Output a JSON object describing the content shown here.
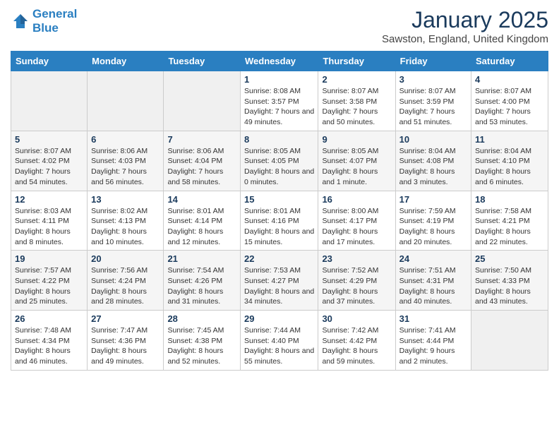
{
  "header": {
    "logo_line1": "General",
    "logo_line2": "Blue",
    "month": "January 2025",
    "location": "Sawston, England, United Kingdom"
  },
  "weekdays": [
    "Sunday",
    "Monday",
    "Tuesday",
    "Wednesday",
    "Thursday",
    "Friday",
    "Saturday"
  ],
  "weeks": [
    [
      {
        "day": "",
        "info": ""
      },
      {
        "day": "",
        "info": ""
      },
      {
        "day": "",
        "info": ""
      },
      {
        "day": "1",
        "info": "Sunrise: 8:08 AM\nSunset: 3:57 PM\nDaylight: 7 hours\nand 49 minutes."
      },
      {
        "day": "2",
        "info": "Sunrise: 8:07 AM\nSunset: 3:58 PM\nDaylight: 7 hours\nand 50 minutes."
      },
      {
        "day": "3",
        "info": "Sunrise: 8:07 AM\nSunset: 3:59 PM\nDaylight: 7 hours\nand 51 minutes."
      },
      {
        "day": "4",
        "info": "Sunrise: 8:07 AM\nSunset: 4:00 PM\nDaylight: 7 hours\nand 53 minutes."
      }
    ],
    [
      {
        "day": "5",
        "info": "Sunrise: 8:07 AM\nSunset: 4:02 PM\nDaylight: 7 hours\nand 54 minutes."
      },
      {
        "day": "6",
        "info": "Sunrise: 8:06 AM\nSunset: 4:03 PM\nDaylight: 7 hours\nand 56 minutes."
      },
      {
        "day": "7",
        "info": "Sunrise: 8:06 AM\nSunset: 4:04 PM\nDaylight: 7 hours\nand 58 minutes."
      },
      {
        "day": "8",
        "info": "Sunrise: 8:05 AM\nSunset: 4:05 PM\nDaylight: 8 hours\nand 0 minutes."
      },
      {
        "day": "9",
        "info": "Sunrise: 8:05 AM\nSunset: 4:07 PM\nDaylight: 8 hours\nand 1 minute."
      },
      {
        "day": "10",
        "info": "Sunrise: 8:04 AM\nSunset: 4:08 PM\nDaylight: 8 hours\nand 3 minutes."
      },
      {
        "day": "11",
        "info": "Sunrise: 8:04 AM\nSunset: 4:10 PM\nDaylight: 8 hours\nand 6 minutes."
      }
    ],
    [
      {
        "day": "12",
        "info": "Sunrise: 8:03 AM\nSunset: 4:11 PM\nDaylight: 8 hours\nand 8 minutes."
      },
      {
        "day": "13",
        "info": "Sunrise: 8:02 AM\nSunset: 4:13 PM\nDaylight: 8 hours\nand 10 minutes."
      },
      {
        "day": "14",
        "info": "Sunrise: 8:01 AM\nSunset: 4:14 PM\nDaylight: 8 hours\nand 12 minutes."
      },
      {
        "day": "15",
        "info": "Sunrise: 8:01 AM\nSunset: 4:16 PM\nDaylight: 8 hours\nand 15 minutes."
      },
      {
        "day": "16",
        "info": "Sunrise: 8:00 AM\nSunset: 4:17 PM\nDaylight: 8 hours\nand 17 minutes."
      },
      {
        "day": "17",
        "info": "Sunrise: 7:59 AM\nSunset: 4:19 PM\nDaylight: 8 hours\nand 20 minutes."
      },
      {
        "day": "18",
        "info": "Sunrise: 7:58 AM\nSunset: 4:21 PM\nDaylight: 8 hours\nand 22 minutes."
      }
    ],
    [
      {
        "day": "19",
        "info": "Sunrise: 7:57 AM\nSunset: 4:22 PM\nDaylight: 8 hours\nand 25 minutes."
      },
      {
        "day": "20",
        "info": "Sunrise: 7:56 AM\nSunset: 4:24 PM\nDaylight: 8 hours\nand 28 minutes."
      },
      {
        "day": "21",
        "info": "Sunrise: 7:54 AM\nSunset: 4:26 PM\nDaylight: 8 hours\nand 31 minutes."
      },
      {
        "day": "22",
        "info": "Sunrise: 7:53 AM\nSunset: 4:27 PM\nDaylight: 8 hours\nand 34 minutes."
      },
      {
        "day": "23",
        "info": "Sunrise: 7:52 AM\nSunset: 4:29 PM\nDaylight: 8 hours\nand 37 minutes."
      },
      {
        "day": "24",
        "info": "Sunrise: 7:51 AM\nSunset: 4:31 PM\nDaylight: 8 hours\nand 40 minutes."
      },
      {
        "day": "25",
        "info": "Sunrise: 7:50 AM\nSunset: 4:33 PM\nDaylight: 8 hours\nand 43 minutes."
      }
    ],
    [
      {
        "day": "26",
        "info": "Sunrise: 7:48 AM\nSunset: 4:34 PM\nDaylight: 8 hours\nand 46 minutes."
      },
      {
        "day": "27",
        "info": "Sunrise: 7:47 AM\nSunset: 4:36 PM\nDaylight: 8 hours\nand 49 minutes."
      },
      {
        "day": "28",
        "info": "Sunrise: 7:45 AM\nSunset: 4:38 PM\nDaylight: 8 hours\nand 52 minutes."
      },
      {
        "day": "29",
        "info": "Sunrise: 7:44 AM\nSunset: 4:40 PM\nDaylight: 8 hours\nand 55 minutes."
      },
      {
        "day": "30",
        "info": "Sunrise: 7:42 AM\nSunset: 4:42 PM\nDaylight: 8 hours\nand 59 minutes."
      },
      {
        "day": "31",
        "info": "Sunrise: 7:41 AM\nSunset: 4:44 PM\nDaylight: 9 hours\nand 2 minutes."
      },
      {
        "day": "",
        "info": ""
      }
    ]
  ]
}
